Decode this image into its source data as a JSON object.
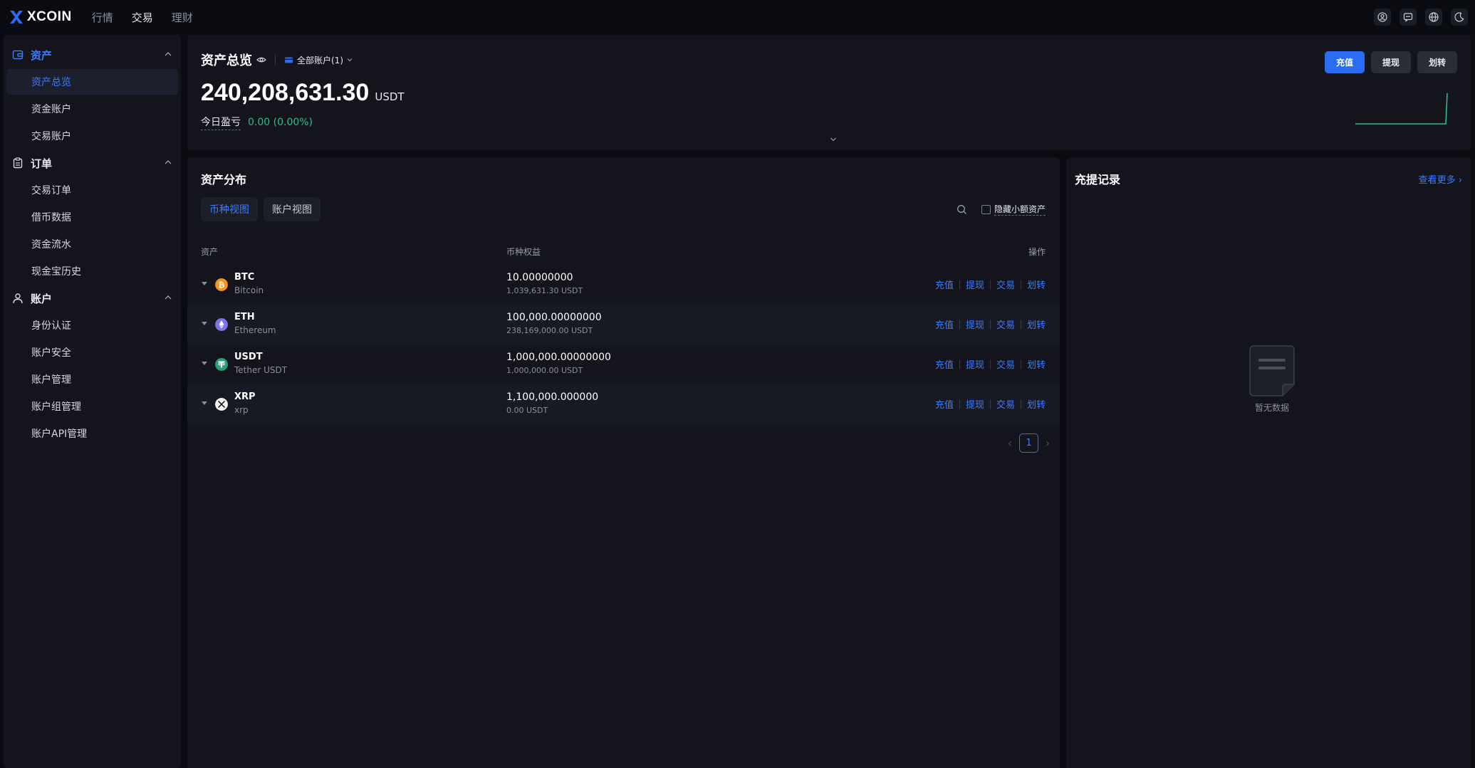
{
  "brand": {
    "name": "XCOIN",
    "color": "#2a6df4"
  },
  "nav": [
    {
      "label": "行情"
    },
    {
      "label": "交易"
    },
    {
      "label": "理财"
    }
  ],
  "top_icons": [
    "user-icon",
    "message-icon",
    "globe-icon",
    "moon-icon"
  ],
  "sidebar": {
    "groups": [
      {
        "label": "资产",
        "icon": "wallet-icon",
        "items": [
          "资产总览",
          "资金账户",
          "交易账户"
        ]
      },
      {
        "label": "订单",
        "icon": "clipboard-icon",
        "items": [
          "交易订单",
          "借币数据",
          "资金流水",
          "现金宝历史"
        ]
      },
      {
        "label": "账户",
        "icon": "person-icon",
        "items": [
          "身份认证",
          "账户安全",
          "账户管理",
          "账户组管理",
          "账户API管理"
        ]
      }
    ]
  },
  "overview": {
    "title": "资产总览",
    "account_selector": "全部账户(1)",
    "total": "240,208,631.30",
    "unit": "USDT",
    "pnl_label": "今日盈亏",
    "pnl_value": "0.00 (0.00%)",
    "buttons": {
      "deposit": "充值",
      "withdraw": "提现",
      "transfer": "划转"
    }
  },
  "distribution": {
    "title": "资产分布",
    "tabs": [
      "币种视图",
      "账户视图"
    ],
    "hide_small_label": "隐藏小额资产",
    "columns": {
      "asset": "资产",
      "equity": "币种权益",
      "ops": "操作"
    },
    "ops": [
      "充值",
      "提现",
      "交易",
      "划转"
    ],
    "rows": [
      {
        "symbol": "BTC",
        "name": "Bitcoin",
        "balance": "10.00000000",
        "usdt": "1,039,631.30 USDT",
        "color": "#f7931a"
      },
      {
        "symbol": "ETH",
        "name": "Ethereum",
        "balance": "100,000.00000000",
        "usdt": "238,169,000.00 USDT",
        "color": "#7b73e8"
      },
      {
        "symbol": "USDT",
        "name": "Tether USDT",
        "balance": "1,000,000.00000000",
        "usdt": "1,000,000.00 USDT",
        "color": "#26a17b"
      },
      {
        "symbol": "XRP",
        "name": "xrp",
        "balance": "1,100,000.000000",
        "usdt": "0.00 USDT",
        "color": "#23292f"
      }
    ],
    "page": "1"
  },
  "records": {
    "title": "充提记录",
    "more": "查看更多",
    "empty_text": "暂无数据"
  }
}
